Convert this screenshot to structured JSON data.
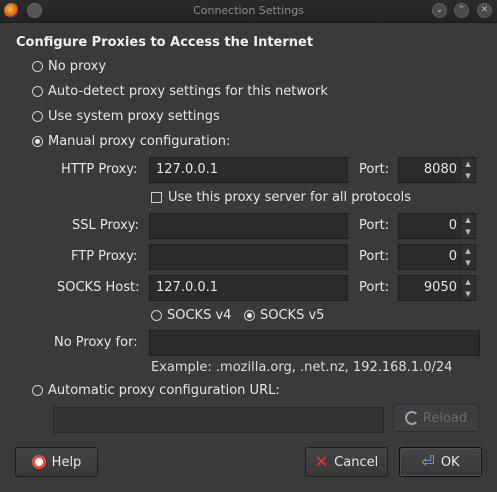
{
  "window": {
    "title": "Connection Settings",
    "app_icon": "firefox-icon"
  },
  "heading": "Configure Proxies to Access the Internet",
  "radios": {
    "no_proxy": "No proxy",
    "auto_detect": "Auto-detect proxy settings for this network",
    "system": "Use system proxy settings",
    "manual": "Manual proxy configuration:",
    "auto_url": "Automatic proxy configuration URL:",
    "selected": "manual"
  },
  "manual": {
    "http_label": "HTTP Proxy:",
    "http_value": "127.0.0.1",
    "http_port_label": "Port:",
    "http_port": "8080",
    "all_protocols": "Use this proxy server for all protocols",
    "ssl_label": "SSL Proxy:",
    "ssl_value": "",
    "ssl_port_label": "Port:",
    "ssl_port": "0",
    "ftp_label": "FTP Proxy:",
    "ftp_value": "",
    "ftp_port_label": "Port:",
    "ftp_port": "0",
    "socks_label": "SOCKS Host:",
    "socks_value": "127.0.0.1",
    "socks_port_label": "Port:",
    "socks_port": "9050",
    "socks_v4": "SOCKS v4",
    "socks_v5": "SOCKS v5",
    "socks_selected": "v5",
    "no_proxy_label": "No Proxy for:",
    "no_proxy_value": "",
    "example": "Example: .mozilla.org, .net.nz, 192.168.1.0/24"
  },
  "auto_url_value": "",
  "buttons": {
    "reload": "Reload",
    "help": "Help",
    "cancel": "Cancel",
    "ok": "OK"
  }
}
